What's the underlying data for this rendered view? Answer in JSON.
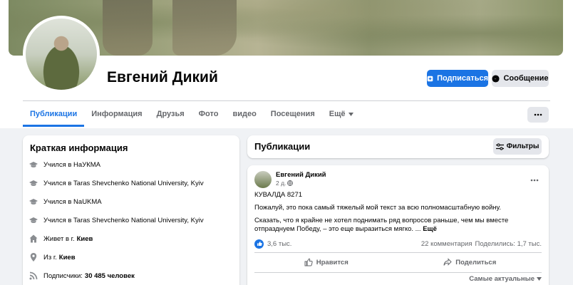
{
  "profile": {
    "name": "Евгений Дикий",
    "subscribe_label": "Подписаться",
    "message_label": "Сообщение"
  },
  "tabs": [
    {
      "label": "Публикации",
      "active": true
    },
    {
      "label": "Информация"
    },
    {
      "label": "Друзья"
    },
    {
      "label": "Фото"
    },
    {
      "label": "видео"
    },
    {
      "label": "Посещения"
    },
    {
      "label": "Ещё"
    }
  ],
  "intro": {
    "title": "Краткая информация",
    "items": [
      {
        "icon": "graduation-cap-icon",
        "text": "Учился в НаУКМА"
      },
      {
        "icon": "graduation-cap-icon",
        "text": "Учился в Taras Shevchenko National University, Kyiv"
      },
      {
        "icon": "graduation-cap-icon",
        "text": "Учился в NaUKMA"
      },
      {
        "icon": "graduation-cap-icon",
        "text": "Учился в Taras Shevchenko National University, Kyiv"
      },
      {
        "icon": "home-icon",
        "text": "Живет в г.",
        "bold": "Киев"
      },
      {
        "icon": "location-pin-icon",
        "text": "Из г.",
        "bold": "Киев"
      },
      {
        "icon": "rss-icon",
        "text": "Подписчики:",
        "bold": "30 485 человек"
      }
    ]
  },
  "posts": {
    "title": "Публикации",
    "filter_label": "Фильтры"
  },
  "post": {
    "author": "Евгений Дикий",
    "time": "2 д.",
    "line1": "КУВАЛДА 8271",
    "line2": "Пожалуй, это пока самый тяжелый мой текст за всю полномасштабную войну.",
    "line3a": "Сказать, что я крайне не хотел поднимать ряд вопросов раньше, чем мы вместе",
    "line3b": "отпразднуем Победу, – это еще выразиться мягко. ...",
    "more": "Ещё",
    "reactions": "3,6 тыс.",
    "comments": "22 комментария",
    "shares": "Поделились: 1,7 тыс.",
    "like_label": "Нравится",
    "share_label": "Поделиться",
    "sort_label": "Самые актуальные"
  },
  "colors": {
    "accent": "#1b74e4",
    "secondary_text": "#65676b",
    "page_bg": "#f0f2f5"
  }
}
